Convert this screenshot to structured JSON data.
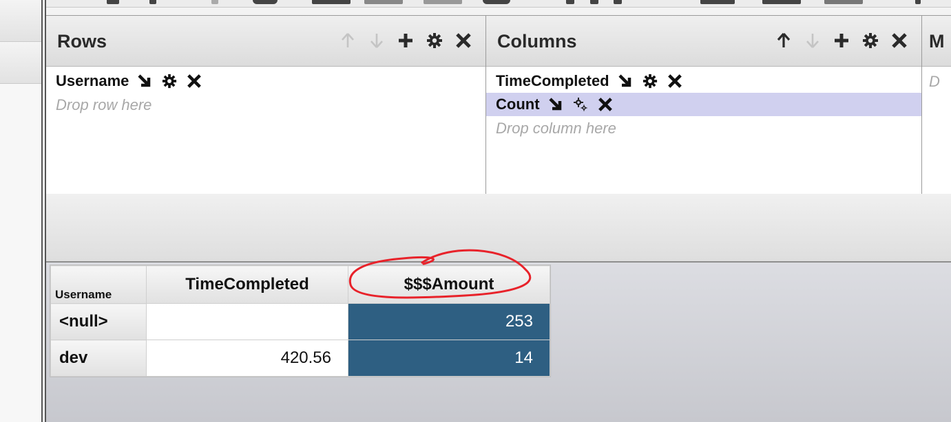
{
  "pivot": {
    "rows_pane": {
      "title": "Rows",
      "fields": [
        {
          "label": "Username",
          "selected": false
        }
      ],
      "drop_hint": "Drop row here"
    },
    "columns_pane": {
      "title": "Columns",
      "fields": [
        {
          "label": "TimeCompleted",
          "selected": false
        },
        {
          "label": "Count",
          "selected": true
        }
      ],
      "drop_hint": "Drop column here"
    },
    "measures_pane": {
      "title_visible": "M",
      "drop_hint_visible": "D"
    },
    "icons": {
      "up": "arrow-up-icon",
      "down": "arrow-down-icon",
      "add": "plus-icon",
      "settings": "gear-icon",
      "remove": "close-icon",
      "sort": "sort-arrow-icon"
    }
  },
  "results": {
    "corner_label": "Username",
    "column_headers": [
      "TimeCompleted",
      "$$$Amount"
    ],
    "rows": [
      {
        "label": "<null>",
        "time_completed": "",
        "amount": "253"
      },
      {
        "label": "dev",
        "time_completed": "420.56",
        "amount": "14"
      }
    ]
  },
  "colors": {
    "measure_cell_bg": "#2e5f82",
    "selected_field_bg": "#d0d0ef",
    "annotation": "#e8222a"
  }
}
